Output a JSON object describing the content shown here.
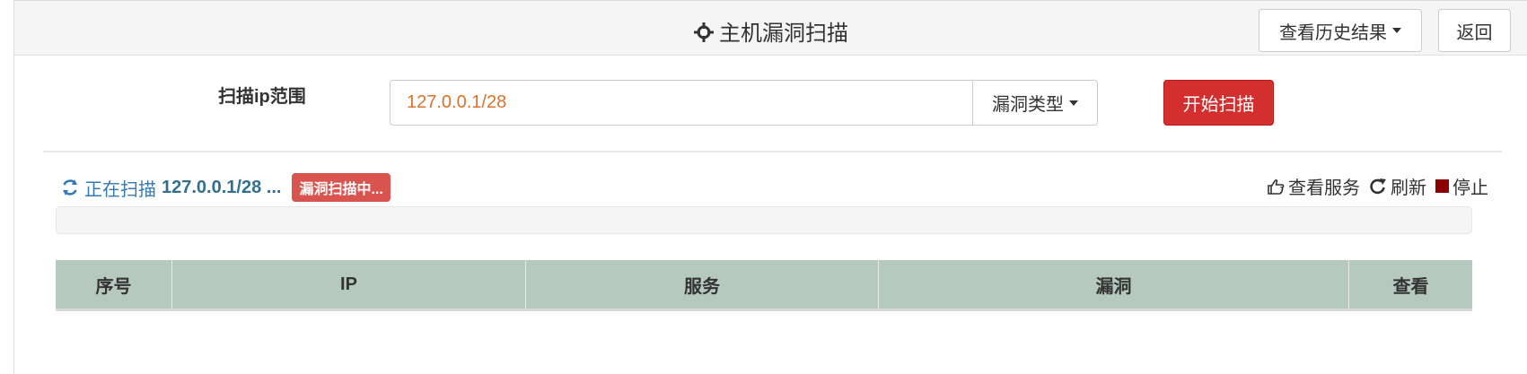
{
  "header": {
    "title": "主机漏洞扫描",
    "history_button": "查看历史结果",
    "back_button": "返回"
  },
  "scan_form": {
    "range_label": "扫描ip范围",
    "range_value": "127.0.0.1/28",
    "vuln_type_button": "漏洞类型",
    "start_button": "开始扫描"
  },
  "status": {
    "prefix": "正在扫描",
    "target": "127.0.0.1/28 ...",
    "badge": "漏洞扫描中...",
    "progress_fraction": 0
  },
  "actions": {
    "view_services": "查看服务",
    "refresh": "刷新",
    "stop": "停止"
  },
  "table": {
    "columns": [
      "序号",
      "IP",
      "服务",
      "漏洞",
      "查看"
    ]
  },
  "colors": {
    "start_button": "#d32f2f",
    "table_header": "#b6c9bf",
    "badge": "#d9534f",
    "input_text": "#d9722a",
    "status_text": "#337ab7",
    "stop_icon": "#8b0000"
  },
  "icons": {
    "title": "crosshair-icon",
    "status": "refresh-spin-icon",
    "view_services": "hand-point-icon",
    "refresh": "refresh-icon",
    "stop": "stop-icon"
  }
}
